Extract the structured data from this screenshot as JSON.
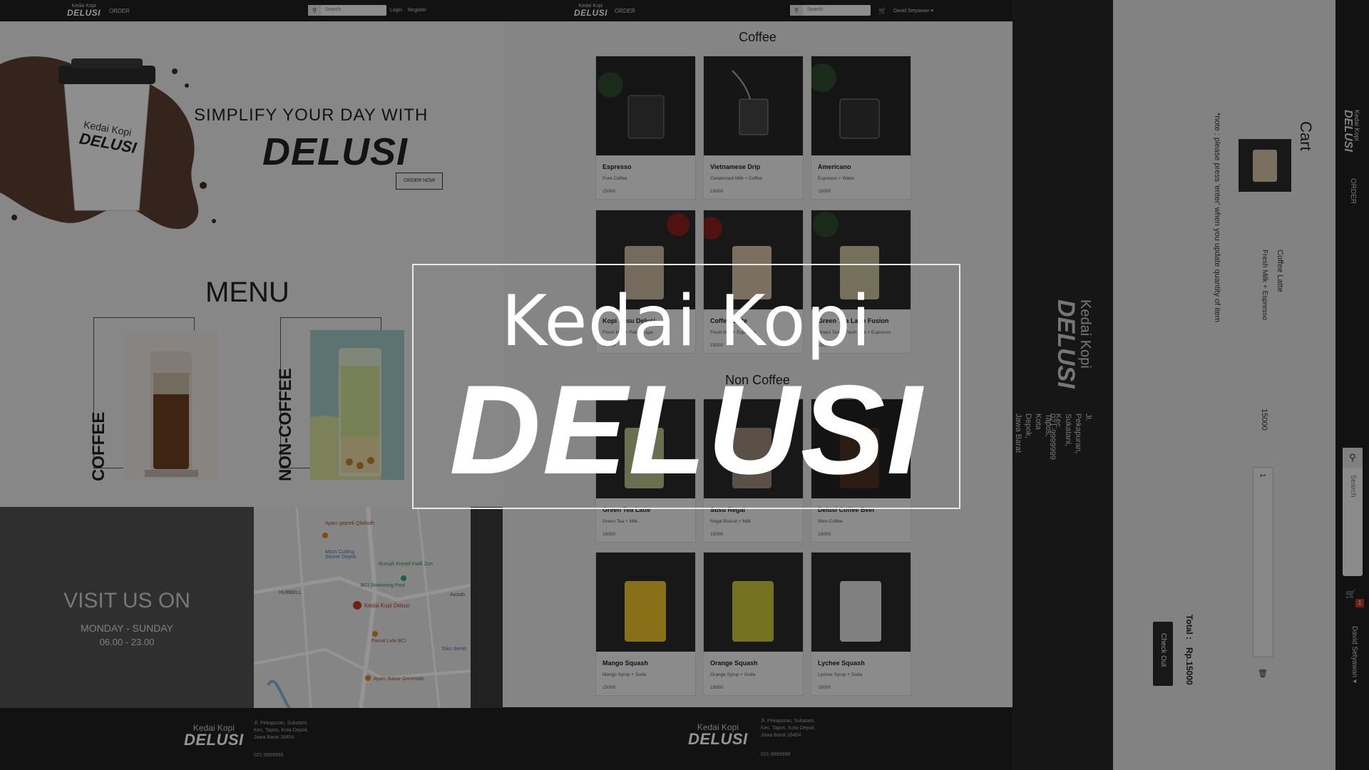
{
  "brand": {
    "small": "Kedai Kopi",
    "big": "DELUSI"
  },
  "nav": {
    "order": "ORDER",
    "login": "Login",
    "register": "Register",
    "user": "David Setyawan ▾",
    "search_placeholder": "Search"
  },
  "hero": {
    "line1": "SIMPLIFY YOUR DAY WITH",
    "line2": "DELUSI",
    "cta": "ORDER NOW",
    "cup_small": "Kedai Kopi",
    "cup_big": "DELUSI"
  },
  "menu": {
    "title": "MENU",
    "cards": [
      {
        "label": "COFFEE"
      },
      {
        "label": "NON-COFFEE"
      }
    ]
  },
  "visit": {
    "title": "VISIT US ON",
    "days": "MONDAY - SUNDAY",
    "hours": "06.00 - 23.00"
  },
  "map": {
    "labels": [
      "Ayam geprek Qilafadh",
      "Maxs Cutting Sticker Depok",
      "Rumah Kreatif Fadli Zon",
      "BCI Swimming Pool",
      "HUBBELL",
      "Kedai Kopi Delusi",
      "Parcel Lele BCI",
      "Toko Semb",
      "Ayam Bakar Gorontalo",
      "Azizah"
    ]
  },
  "footer": {
    "address": "Jl. Pekapuran, Sukatani,\nKec. Tapos, Kota Depok,\nJawa Barat 16454",
    "phone": "021-9999999"
  },
  "sections": {
    "coffee": "Coffee",
    "non_coffee": "Non Coffee"
  },
  "products": [
    {
      "name": "Espresso",
      "desc": "Pure Coffee",
      "price": "15000"
    },
    {
      "name": "Vietnamese Drip",
      "desc": "Condensed Milk + Coffee",
      "price": "15000"
    },
    {
      "name": "Americano",
      "desc": "Espresso + Water",
      "price": "15000"
    },
    {
      "name": "Kopi Susu Delusi",
      "desc": "Fresh Milk + Palm Sugar",
      "price": "15000"
    },
    {
      "name": "Coffee Latte",
      "desc": "Fresh Milk + Espresso",
      "price": "15000"
    },
    {
      "name": "Green Tea Latte Fusion",
      "desc": "Green Tea + Fresh Milk + Espresso",
      "price": "15000"
    },
    {
      "name": "Green Tea Latte",
      "desc": "Green Tea + Milk",
      "price": "15000"
    },
    {
      "name": "Susu Regal",
      "desc": "Regal Biscuit + Milk",
      "price": "15000"
    },
    {
      "name": "Delusi Coffee Beer",
      "desc": "Nitro Coffee",
      "price": "15000"
    },
    {
      "name": "Mango Squash",
      "desc": "Mango Syrup + Soda",
      "price": "15000"
    },
    {
      "name": "Orange Squash",
      "desc": "Orange Syrup + Soda",
      "price": "15000"
    },
    {
      "name": "Lychee Squash",
      "desc": "Lychee Syrup + Soda",
      "price": "15000"
    }
  ],
  "cart": {
    "title": "Cart",
    "note": "*note : please press 'enter' when you update quantity of item",
    "item_name": "Coffee Latte",
    "item_desc": "Fresh Milk + Espresso",
    "item_price": "15000",
    "qty": "1",
    "total_label": "Total :",
    "total_value": "Rp.15000",
    "checkout": "Check Out",
    "cart_count": "1"
  },
  "overlay": {
    "top": "Kedai Kopi",
    "main": "DELUSI"
  },
  "colors": {
    "dark": "#1f1f1f",
    "overlay": "rgba(0,0,0,0.42)"
  }
}
